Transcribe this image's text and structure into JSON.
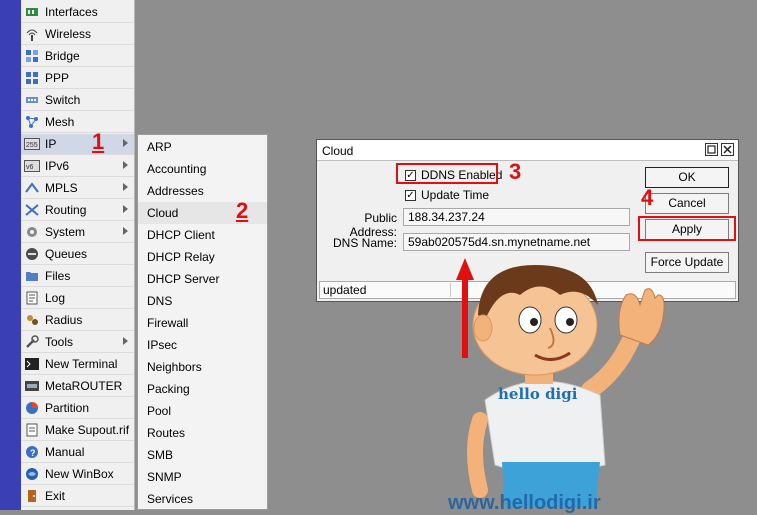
{
  "main_menu": {
    "items": [
      {
        "label": "Interfaces",
        "icon": "interfaces-icon",
        "has_submenu": false
      },
      {
        "label": "Wireless",
        "icon": "wireless-icon",
        "has_submenu": false
      },
      {
        "label": "Bridge",
        "icon": "bridge-icon",
        "has_submenu": false
      },
      {
        "label": "PPP",
        "icon": "ppp-icon",
        "has_submenu": false
      },
      {
        "label": "Switch",
        "icon": "switch-icon",
        "has_submenu": false
      },
      {
        "label": "Mesh",
        "icon": "mesh-icon",
        "has_submenu": false
      },
      {
        "label": "IP",
        "icon": "ip-icon",
        "has_submenu": true
      },
      {
        "label": "IPv6",
        "icon": "ipv6-icon",
        "has_submenu": true
      },
      {
        "label": "MPLS",
        "icon": "mpls-icon",
        "has_submenu": true
      },
      {
        "label": "Routing",
        "icon": "routing-icon",
        "has_submenu": true
      },
      {
        "label": "System",
        "icon": "system-icon",
        "has_submenu": true
      },
      {
        "label": "Queues",
        "icon": "queues-icon",
        "has_submenu": false
      },
      {
        "label": "Files",
        "icon": "files-icon",
        "has_submenu": false
      },
      {
        "label": "Log",
        "icon": "log-icon",
        "has_submenu": false
      },
      {
        "label": "Radius",
        "icon": "radius-icon",
        "has_submenu": false
      },
      {
        "label": "Tools",
        "icon": "tools-icon",
        "has_submenu": true
      },
      {
        "label": "New Terminal",
        "icon": "terminal-icon",
        "has_submenu": false
      },
      {
        "label": "MetaROUTER",
        "icon": "metarouter-icon",
        "has_submenu": false
      },
      {
        "label": "Partition",
        "icon": "partition-icon",
        "has_submenu": false
      },
      {
        "label": "Make Supout.rif",
        "icon": "supout-icon",
        "has_submenu": false
      },
      {
        "label": "Manual",
        "icon": "manual-icon",
        "has_submenu": false
      },
      {
        "label": "New WinBox",
        "icon": "winbox-icon",
        "has_submenu": false
      },
      {
        "label": "Exit",
        "icon": "exit-icon",
        "has_submenu": false
      }
    ]
  },
  "ip_submenu": {
    "items": [
      "ARP",
      "Accounting",
      "Addresses",
      "Cloud",
      "DHCP Client",
      "DHCP Relay",
      "DHCP Server",
      "DNS",
      "Firewall",
      "IPsec",
      "Neighbors",
      "Packing",
      "Pool",
      "Routes",
      "SMB",
      "SNMP",
      "Services"
    ],
    "selected": "Cloud"
  },
  "cloud_window": {
    "title": "Cloud",
    "ddns_enabled_label": "DDNS Enabled",
    "ddns_enabled": true,
    "update_time_label": "Update Time",
    "update_time": true,
    "public_address_label": "Public Address:",
    "public_address": "188.34.237.24",
    "dns_name_label": "DNS Name:",
    "dns_name": "59ab020575d4.sn.mynetname.net",
    "buttons": {
      "ok": "OK",
      "cancel": "Cancel",
      "apply": "Apply",
      "force_update": "Force Update"
    },
    "status": "updated"
  },
  "annotations": {
    "step1": "1",
    "step2": "2",
    "step3": "3",
    "step4": "4"
  },
  "mascot": {
    "shirt_text": "hello digi",
    "watermark": "www.hellodigi.ir"
  },
  "colors": {
    "accent_red": "#e01010",
    "strip_blue": "#3b3fb6",
    "shirt_blue": "#3da2d8"
  }
}
